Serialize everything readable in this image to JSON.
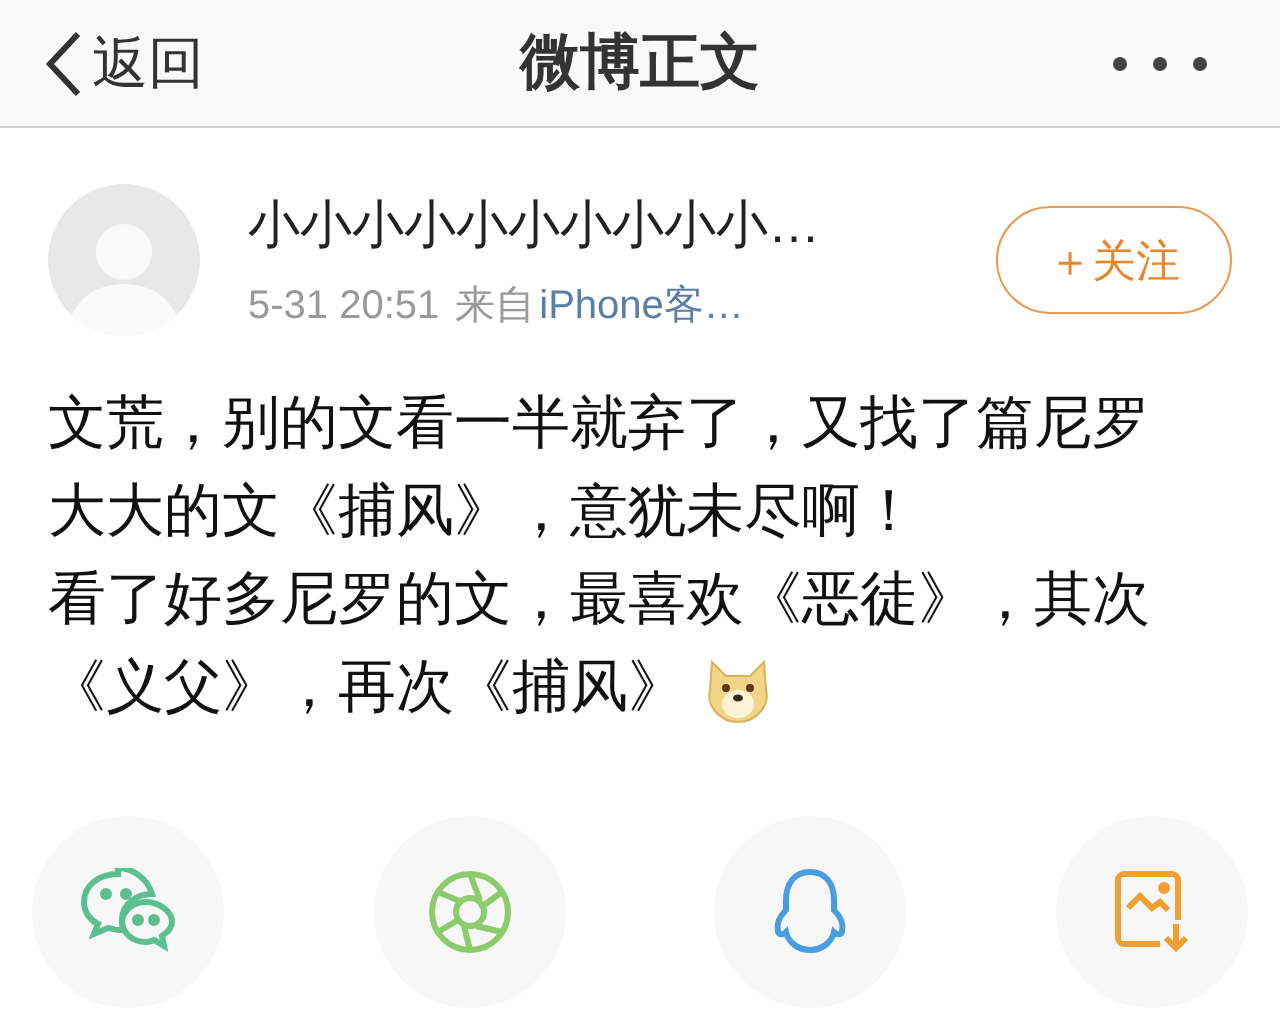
{
  "header": {
    "back_label": "返回",
    "title": "微博正文"
  },
  "post": {
    "author": "小小小小小小小小小小…",
    "time": "5-31 20:51",
    "source_prefix": "来自",
    "source": "iPhone客…",
    "follow_label": "＋关注",
    "followed": false,
    "paragraphs": [
      "文荒，别的文看一半就弃了，又找了篇尼罗大大的文《捕风》，意犹未尽啊！",
      "看了好多尼罗的文，最喜欢《恶徒》，其次《义父》，再次《捕风》"
    ]
  },
  "share": [
    {
      "kind": "chat"
    },
    {
      "kind": "aperture"
    },
    {
      "kind": "penguin"
    },
    {
      "kind": "save-image"
    }
  ]
}
